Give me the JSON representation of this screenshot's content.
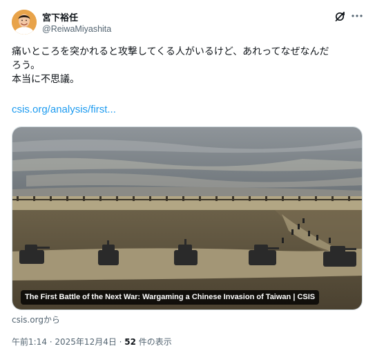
{
  "author": {
    "display_name": "宮下裕任",
    "handle": "@ReiwaMiyashita"
  },
  "icons": {
    "grok": "grok-icon",
    "more": "more-icon"
  },
  "tweet": {
    "lines": [
      "痛いところを突かれると攻撃してくる人がいるけど、あれってなぜなんだ",
      "ろう。",
      "本当に不思議。"
    ],
    "link_text": "csis.org/analysis/first..."
  },
  "card": {
    "caption": "The First Battle of the Next War: Wargaming a Chinese Invasion of Taiwan | CSIS",
    "source": "csis.orgから"
  },
  "meta": {
    "timestamp": "午前1:14 · 2025年12月4日 · ",
    "views_count": "52",
    "views_suffix": " 件の表示"
  },
  "colors": {
    "link": "#1d9bf0",
    "secondary_text": "#536471",
    "primary_text": "#0f1419"
  }
}
